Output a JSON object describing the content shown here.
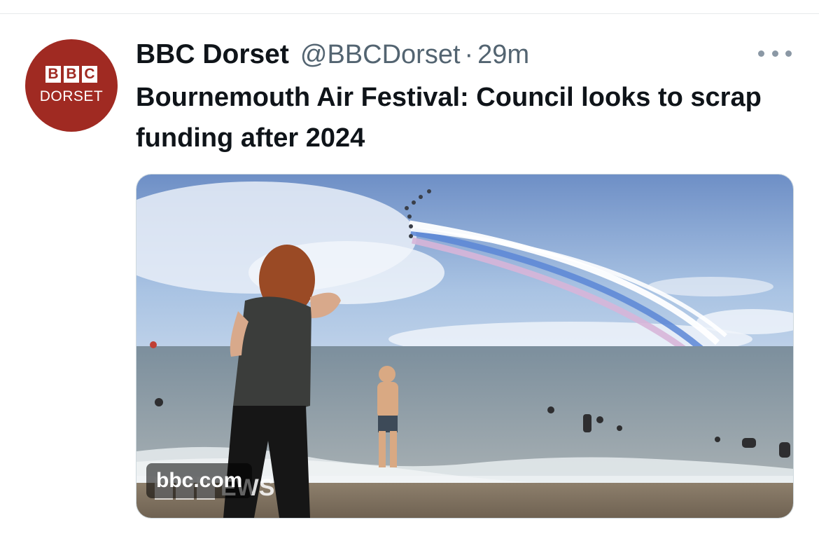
{
  "account": {
    "display_name": "BBC Dorset",
    "handle": "@BBCDorset",
    "separator": "·",
    "time": "29m",
    "avatar_letters": [
      "B",
      "B",
      "C"
    ],
    "avatar_subtitle": "DORSET"
  },
  "tweet": {
    "text": "Bournemouth Air Festival: Council looks to scrap funding after 2024"
  },
  "card": {
    "domain": "bbc.com",
    "watermark_text": "EWS"
  },
  "icons": {
    "more": "more-dots-icon"
  },
  "colors": {
    "avatar_bg": "#a02a22",
    "text_primary": "#0f1419",
    "text_secondary": "#536471"
  }
}
